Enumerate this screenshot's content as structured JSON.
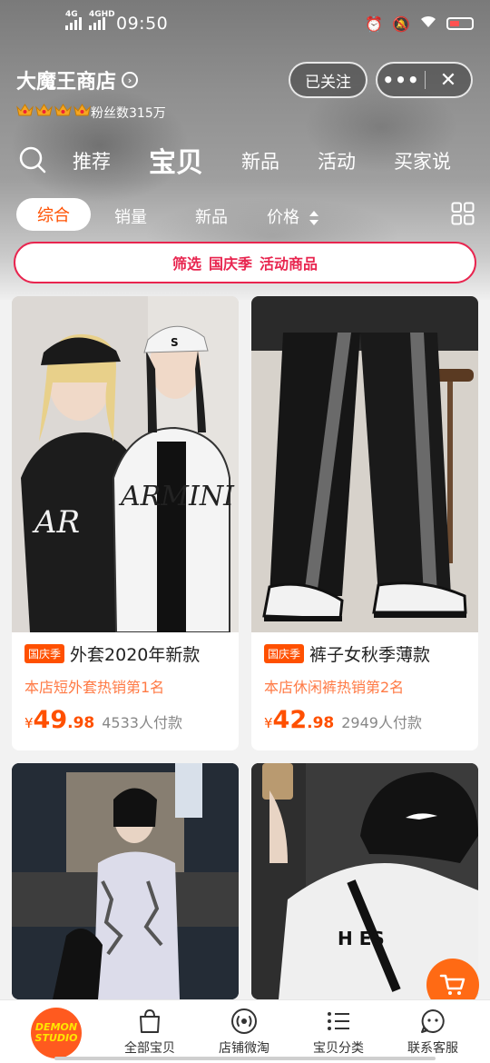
{
  "status_bar": {
    "time": "09:50",
    "net1": "4G",
    "net2": "4GHD"
  },
  "shop": {
    "name": "大魔王商店",
    "fans": "粉丝数315万",
    "follow_label": "已关注"
  },
  "tabs": [
    {
      "label": "推荐"
    },
    {
      "label": "宝贝"
    },
    {
      "label": "新品"
    },
    {
      "label": "活动"
    },
    {
      "label": "买家说"
    }
  ],
  "sort": {
    "items": [
      "综合",
      "销量",
      "新品",
      "价格"
    ]
  },
  "filter_banner": {
    "parts": [
      "筛选",
      "国庆季",
      "活动商品"
    ]
  },
  "products": [
    {
      "tag": "国庆季",
      "title": "外套2020年新款",
      "rank": "本店短外套热销第1名",
      "price_int": "49",
      "price_dec": ".98",
      "sold": "4533人付款"
    },
    {
      "tag": "国庆季",
      "title": "裤子女秋季薄款",
      "rank": "本店休闲裤热销第2名",
      "price_int": "42",
      "price_dec": ".98",
      "sold": "2949人付款"
    }
  ],
  "price_symbol": "¥",
  "bottom_nav": {
    "logo_text": "DEMON STUDIO",
    "items": [
      {
        "label": "全部宝贝",
        "icon": "bag-icon"
      },
      {
        "label": "店铺微淘",
        "icon": "broadcast-icon"
      },
      {
        "label": "宝贝分类",
        "icon": "category-list-icon"
      },
      {
        "label": "联系客服",
        "icon": "chat-icon"
      }
    ]
  },
  "colors": {
    "accent": "#ff5000",
    "banner_border": "#e8254f",
    "rank_text": "#ff7a45"
  }
}
